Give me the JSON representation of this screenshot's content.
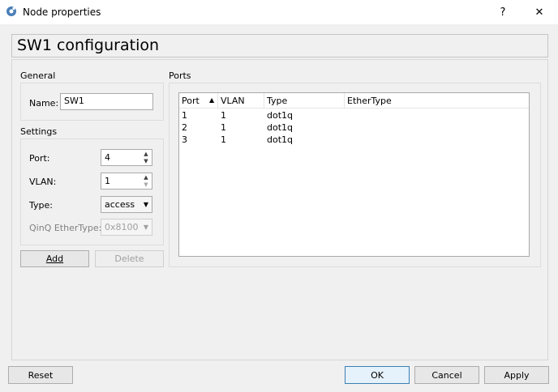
{
  "window": {
    "title": "Node properties",
    "help_label": "?",
    "close_label": "✕"
  },
  "header": {
    "title": "SW1 configuration"
  },
  "general": {
    "group_label": "General",
    "name_label": "Name:",
    "name_value": "SW1"
  },
  "settings": {
    "group_label": "Settings",
    "port_label": "Port:",
    "port_value": "4",
    "vlan_label": "VLAN:",
    "vlan_value": "1",
    "type_label": "Type:",
    "type_value": "access",
    "qinq_label": "QinQ EtherType:",
    "qinq_value": "0x8100",
    "add_label": "Add",
    "delete_label": "Delete"
  },
  "ports": {
    "group_label": "Ports",
    "columns": [
      "Port",
      "VLAN",
      "Type",
      "EtherType"
    ],
    "sort_indicator": "▲",
    "rows": [
      [
        "1",
        "1",
        "dot1q",
        ""
      ],
      [
        "2",
        "1",
        "dot1q",
        ""
      ],
      [
        "3",
        "1",
        "dot1q",
        ""
      ]
    ]
  },
  "footer": {
    "reset_label": "Reset",
    "ok_label": "OK",
    "cancel_label": "Cancel",
    "apply_label": "Apply"
  },
  "icons": {
    "app": "gns3-node-icon",
    "accent": "#3c7fb1"
  }
}
